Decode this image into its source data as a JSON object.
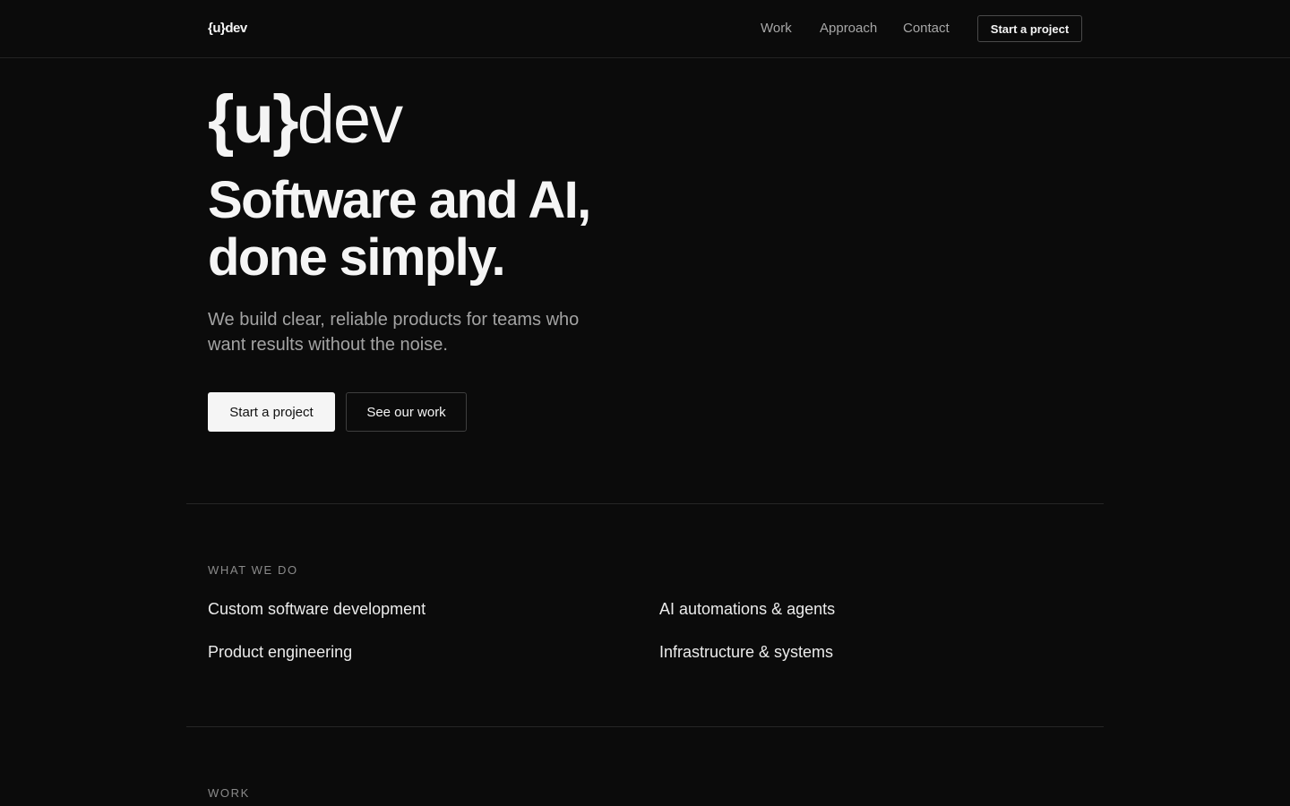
{
  "header": {
    "logo": "{u}dev",
    "nav": [
      "Work",
      "Approach",
      "Contact"
    ],
    "cta_label": "Start a project"
  },
  "hero": {
    "logo_brace": "{u}",
    "logo_text": "dev",
    "headline_line1": "Software and AI,",
    "headline_line2": "done simply.",
    "subtext": "We build clear, reliable products for teams who want results without the noise.",
    "primary_button": "Start a project",
    "secondary_button": "See our work"
  },
  "what_we_do": {
    "label": "WHAT WE DO",
    "services": [
      "Custom software development",
      "AI automations & agents",
      "Product engineering",
      "Infrastructure & systems"
    ]
  },
  "work": {
    "label": "WORK"
  },
  "colors": {
    "background": "#0b0b0b",
    "text": "#f5f5f5",
    "muted": "#a3a3a3",
    "border": "#262626"
  }
}
